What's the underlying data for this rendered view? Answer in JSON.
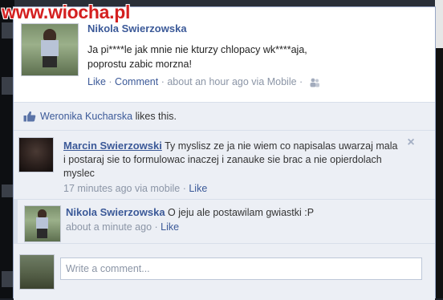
{
  "watermark": "www.wiocha.pl",
  "post": {
    "author": "Nikola Swierzowska",
    "text_line1": "Ja pi****le jak mnie nie kturzy chlopacy wk****aja,",
    "text_line2": "poprostu zabic morzna!",
    "like": "Like",
    "comment": "Comment",
    "time": "about an hour ago via Mobile",
    "separator": " · ",
    "audience_icon": "friends-icon"
  },
  "likes": {
    "icon": "thumbs-up-icon",
    "name": "Weronika Kucharska",
    "suffix": " likes this."
  },
  "comments": [
    {
      "author": "Marcin Swierzowski",
      "text": "Ty myslisz ze ja nie wiem co napisalas uwarzaj mala i postaraj sie to formulowac inaczej i zanauke sie brac a nie opierdolach myslec",
      "time": "17 minutes ago via mobile",
      "like": "Like",
      "close_icon": "close-icon"
    },
    {
      "author": "Nikola Swierzowska",
      "text": "O jeju ale postawilam gwiastki :P",
      "time": "about a minute ago",
      "like": "Like"
    }
  ],
  "compose": {
    "placeholder": "Write a comment..."
  },
  "colors": {
    "link": "#3b5998",
    "meta": "#8b95a6",
    "feed_bg": "#eceff5",
    "border": "#d8dfea",
    "watermark": "#d42020"
  }
}
